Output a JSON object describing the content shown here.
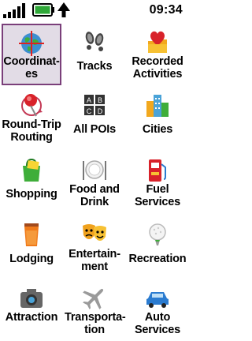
{
  "status": {
    "time": "09:34",
    "signal_icon": "signal-bars-icon",
    "battery_icon": "battery-icon",
    "gps_icon": "gps-arrow-icon",
    "battery_color": "#2fa838"
  },
  "menu": {
    "items": [
      {
        "label": "Coordinat-\nes",
        "icon": "globe-crosshair-icon",
        "selected": true
      },
      {
        "label": "Tracks",
        "icon": "footprints-icon"
      },
      {
        "label": "Recorded\nActivities",
        "icon": "heart-folder-icon"
      },
      {
        "label": "Round-Trip\nRouting",
        "icon": "pushpin-loop-icon"
      },
      {
        "label": "All POIs",
        "icon": "abc-blocks-icon"
      },
      {
        "label": "Cities",
        "icon": "city-buildings-icon"
      },
      {
        "label": "Shopping",
        "icon": "shopping-bag-icon"
      },
      {
        "label": "Food and\nDrink",
        "icon": "plate-fork-knife-icon"
      },
      {
        "label": "Fuel\nServices",
        "icon": "fuel-pump-icon"
      },
      {
        "label": "Lodging",
        "icon": "lodging-drink-icon"
      },
      {
        "label": "Entertain-\nment",
        "icon": "theater-masks-icon"
      },
      {
        "label": "Recreation",
        "icon": "golf-ball-icon"
      },
      {
        "label": "Attraction",
        "icon": "camera-icon"
      },
      {
        "label": "Transporta-\ntion",
        "icon": "airplane-icon"
      },
      {
        "label": "Auto\nServices",
        "icon": "car-icon"
      }
    ]
  }
}
